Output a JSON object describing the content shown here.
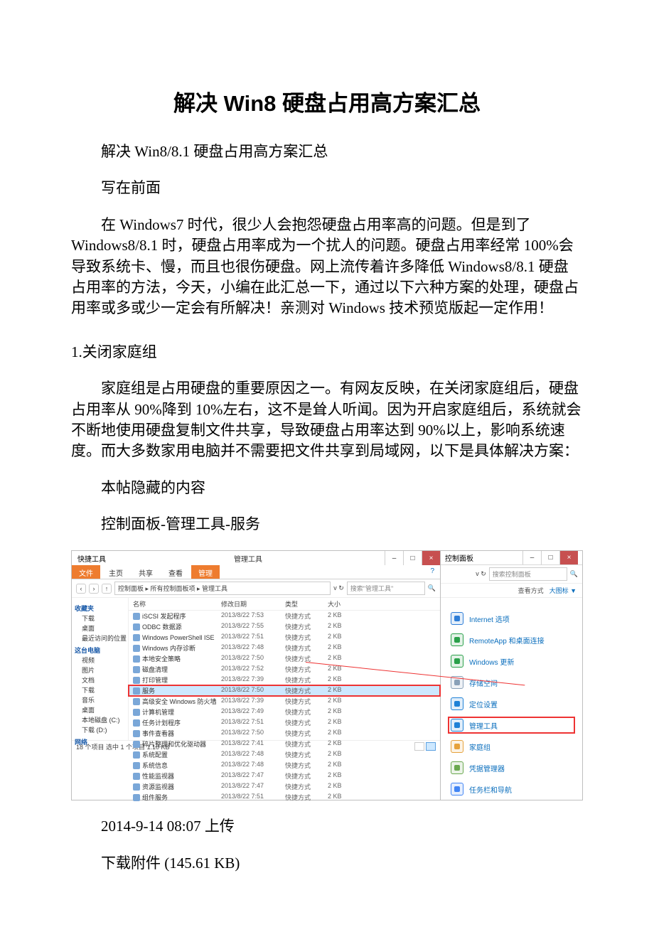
{
  "title": "解决 Win8 硬盘占用高方案汇总",
  "subtitle": "解决 Win8/8.1 硬盘占用高方案汇总",
  "label_preface": "写在前面",
  "preface_body": "在 Windows7 时代，很少人会抱怨硬盘占用率高的问题。但是到了 Windows8/8.1 时，硬盘占用率成为一个扰人的问题。硬盘占用率经常 100%会导致系统卡、慢，而且也很伤硬盘。网上流传着许多降低 Windows8/8.1 硬盘占用率的方法，今天，小编在此汇总一下，通过以下六种方案的处理，硬盘占用率或多或少一定会有所解决！亲测对 Windows 技术预览版起一定作用！",
  "section1_heading": "1.关闭家庭组",
  "section1_body": "家庭组是占用硬盘的重要原因之一。有网友反映，在关闭家庭组后，硬盘占用率从 90%降到 10%左右，这不是耸人听闻。因为开启家庭组后，系统就会不断地使用硬盘复制文件共享，导致硬盘占用率达到 90%以上，影响系统速度。而大多数家用电脑并不需要把文件共享到局域网，以下是具体解决方案：",
  "hidden_label": "本帖隐藏的内容",
  "path_text": "控制面板-管理工具-服务",
  "upload_line": "2014-9-14 08:07 上传",
  "download_line": "下载附件 (145.61 KB)",
  "shot": {
    "left": {
      "ribbon_file": "文件",
      "ribbon_tabs": [
        "主页",
        "共享",
        "查看",
        "管理"
      ],
      "ribbon_context": "快捷工具",
      "title": "管理工具",
      "winbtn_min": "–",
      "winbtn_max": "□",
      "winbtn_close": "×",
      "help": "?",
      "nav_back": "‹",
      "nav_fwd": "›",
      "nav_up": "↑",
      "breadcrumb": "控制面板 ▸ 所有控制面板项 ▸ 管理工具",
      "refresh_label": "v ↻",
      "search_placeholder": "搜索\"管理工具\"",
      "search_icon": "🔍",
      "nav_groups": {
        "fav": "收藏夹",
        "fav_items": [
          "下载",
          "桌面",
          "最近访问的位置"
        ],
        "thispc": "这台电脑",
        "pc_items": [
          "视频",
          "图片",
          "文档",
          "下载",
          "音乐",
          "桌面",
          "本地磁盘 (C:)",
          "下载 (D:)"
        ],
        "network": "网络"
      },
      "cols": {
        "name": "名称",
        "date": "修改日期",
        "type": "类型",
        "size": "大小"
      },
      "rows": [
        {
          "name": "iSCSI 发起程序",
          "date": "2013/8/22 7:53",
          "type": "快捷方式",
          "size": "2 KB"
        },
        {
          "name": "ODBC 数据源",
          "date": "2013/8/22 7:55",
          "type": "快捷方式",
          "size": "2 KB"
        },
        {
          "name": "Windows PowerShell ISE",
          "date": "2013/8/22 7:51",
          "type": "快捷方式",
          "size": "2 KB"
        },
        {
          "name": "Windows 内存诊断",
          "date": "2013/8/22 7:48",
          "type": "快捷方式",
          "size": "2 KB"
        },
        {
          "name": "本地安全策略",
          "date": "2013/8/22 7:50",
          "type": "快捷方式",
          "size": "2 KB"
        },
        {
          "name": "磁盘清理",
          "date": "2013/8/22 7:52",
          "type": "快捷方式",
          "size": "2 KB"
        },
        {
          "name": "打印管理",
          "date": "2013/8/22 7:39",
          "type": "快捷方式",
          "size": "2 KB"
        },
        {
          "name": "服务",
          "date": "2013/8/22 7:50",
          "type": "快捷方式",
          "size": "2 KB",
          "sel": true,
          "red": true
        },
        {
          "name": "高级安全 Windows 防火墙",
          "date": "2013/8/22 7:39",
          "type": "快捷方式",
          "size": "2 KB"
        },
        {
          "name": "计算机管理",
          "date": "2013/8/22 7:49",
          "type": "快捷方式",
          "size": "2 KB"
        },
        {
          "name": "任务计划程序",
          "date": "2013/8/22 7:51",
          "type": "快捷方式",
          "size": "2 KB"
        },
        {
          "name": "事件查看器",
          "date": "2013/8/22 7:50",
          "type": "快捷方式",
          "size": "2 KB"
        },
        {
          "name": "碎片整理和优化驱动器",
          "date": "2013/8/22 7:41",
          "type": "快捷方式",
          "size": "2 KB"
        },
        {
          "name": "系统配置",
          "date": "2013/8/22 7:48",
          "type": "快捷方式",
          "size": "2 KB"
        },
        {
          "name": "系统信息",
          "date": "2013/8/22 7:48",
          "type": "快捷方式",
          "size": "2 KB"
        },
        {
          "name": "性能监视器",
          "date": "2013/8/22 7:47",
          "type": "快捷方式",
          "size": "2 KB"
        },
        {
          "name": "资源监视器",
          "date": "2013/8/22 7:47",
          "type": "快捷方式",
          "size": "2 KB"
        },
        {
          "name": "组件服务",
          "date": "2013/8/22 7:51",
          "type": "快捷方式",
          "size": "2 KB"
        }
      ],
      "status": "18 个项目    选中 1 个项目 1.10 KB"
    },
    "right": {
      "title": "控制面板",
      "search_placeholder": "搜索控制面板",
      "search_hint": "v ↻",
      "link_view": "查看方式",
      "link_icons": "大图标 ▼",
      "links": [
        {
          "label": "Internet 选项",
          "color": "#2e7dd7"
        },
        {
          "label": "RemoteApp 和桌面连接",
          "color": "#2aa04a"
        },
        {
          "label": "Windows 更新",
          "color": "#2aa04a"
        },
        {
          "label": "存储空间",
          "color": "#8aa1b8"
        },
        {
          "label": "定位设置",
          "color": "#1f81d6"
        },
        {
          "label": "管理工具",
          "color": "#1f81d6",
          "red": true
        },
        {
          "label": "家庭组",
          "color": "#e6a23c"
        },
        {
          "label": "凭据管理器",
          "color": "#6aa84f"
        },
        {
          "label": "任务栏和导航",
          "color": "#4285f4"
        }
      ]
    }
  }
}
